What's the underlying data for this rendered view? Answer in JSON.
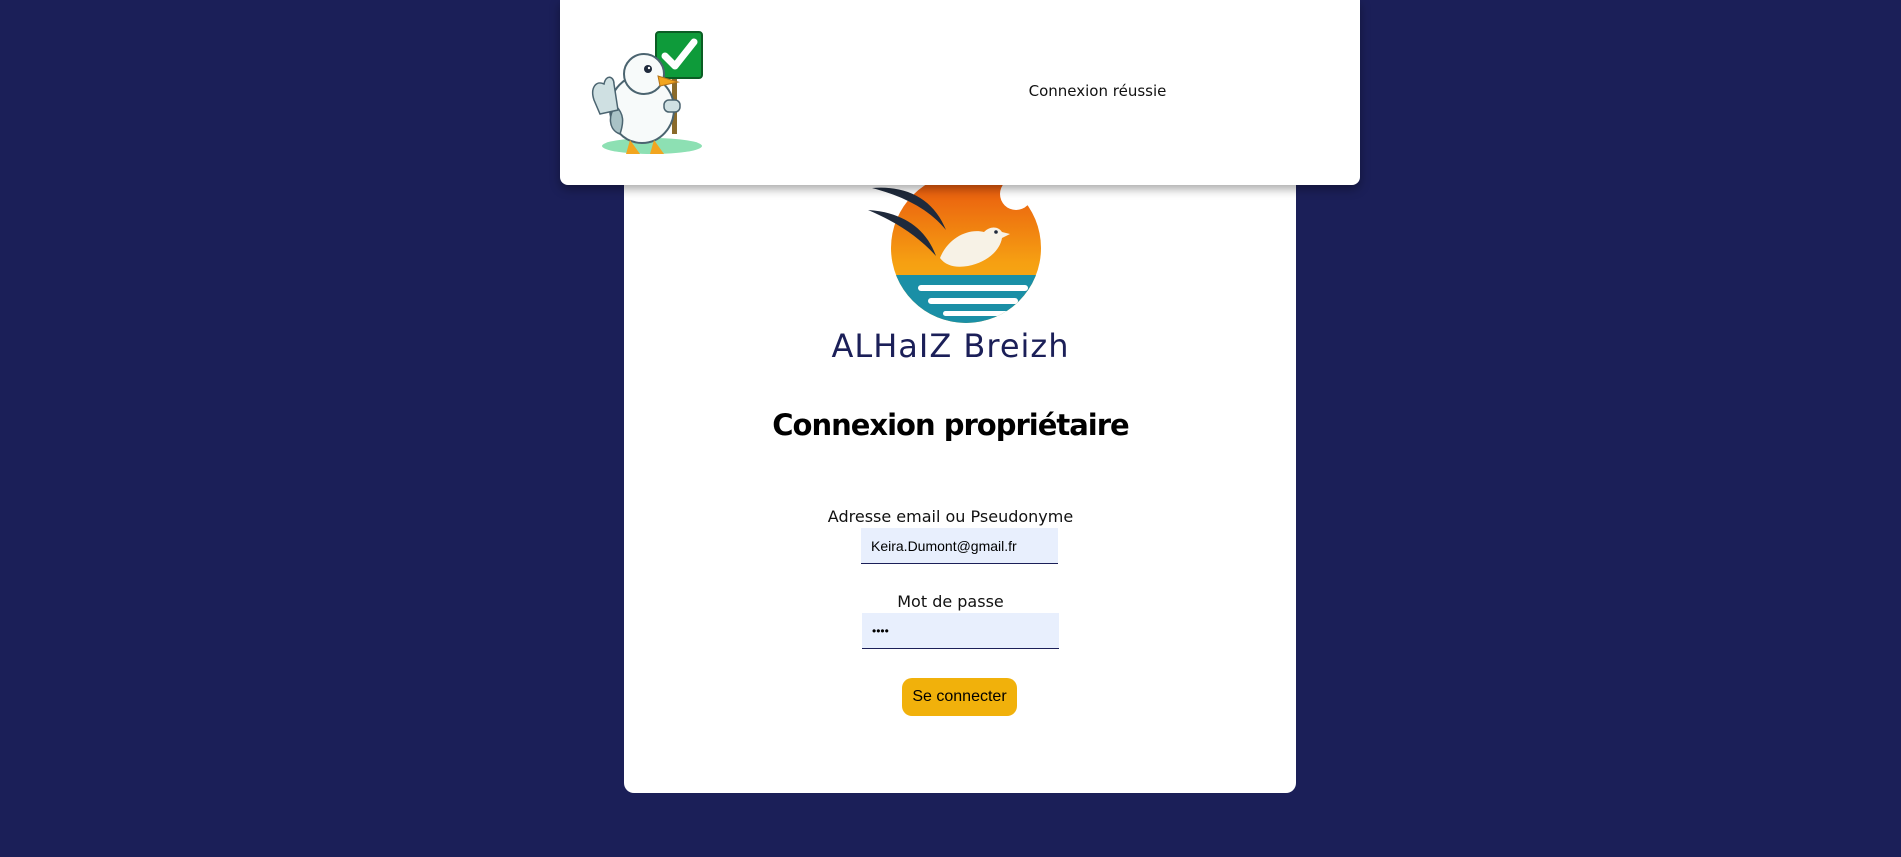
{
  "brand": {
    "name": "ALHaIZ Breizh",
    "color": "#1b1f58"
  },
  "login": {
    "title": "Connexion propriétaire",
    "identifier_label": "Adresse email ou Pseudonyme",
    "identifier_value": "Keira.Dumont@gmail.fr",
    "password_label": "Mot de passe",
    "password_value": "••••",
    "submit_label": "Se connecter"
  },
  "toast": {
    "message": "Connexion réussie",
    "icon": "seagull-mascot-checkmark-icon"
  },
  "colors": {
    "background": "#1b1f58",
    "accent_button": "#f1b10b",
    "input_background": "#e8effd"
  }
}
